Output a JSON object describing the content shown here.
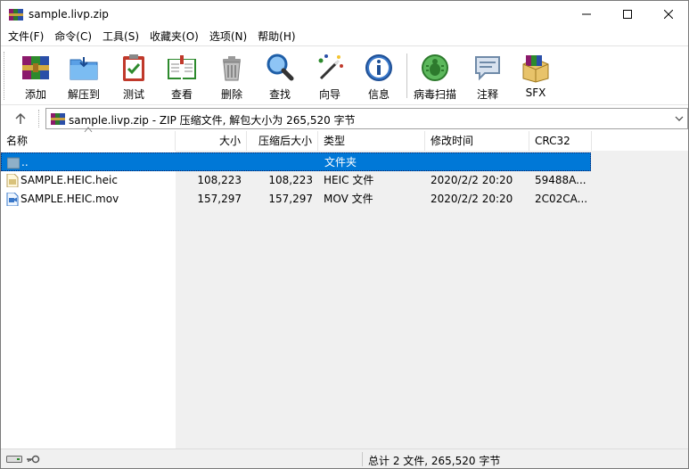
{
  "window": {
    "title": "sample.livp.zip"
  },
  "menu": [
    "文件(F)",
    "命令(C)",
    "工具(S)",
    "收藏夹(O)",
    "选项(N)",
    "帮助(H)"
  ],
  "toolbar": {
    "add": "添加",
    "extract": "解压到",
    "test": "测试",
    "view": "查看",
    "delete": "删除",
    "find": "查找",
    "wizard": "向导",
    "info": "信息",
    "virus": "病毒扫描",
    "comment": "注释",
    "sfx": "SFX"
  },
  "address": {
    "text": "sample.livp.zip - ZIP 压缩文件, 解包大小为 265,520 字节"
  },
  "columns": {
    "name": "名称",
    "size": "大小",
    "packed": "压缩后大小",
    "type": "类型",
    "modified": "修改时间",
    "crc": "CRC32"
  },
  "rows": [
    {
      "name": "..",
      "size": "",
      "packed": "",
      "type": "文件夹",
      "modified": "",
      "crc": ""
    },
    {
      "name": "SAMPLE.HEIC.heic",
      "size": "108,223",
      "packed": "108,223",
      "type": "HEIC 文件",
      "modified": "2020/2/2 20:20",
      "crc": "59488A..."
    },
    {
      "name": "SAMPLE.HEIC.mov",
      "size": "157,297",
      "packed": "157,297",
      "type": "MOV 文件",
      "modified": "2020/2/2 20:20",
      "crc": "2C02CA..."
    }
  ],
  "status": {
    "text": "总计 2 文件, 265,520 字节"
  },
  "colors": {
    "selection": "#0078d7",
    "empty_area": "#f0f0f0"
  }
}
